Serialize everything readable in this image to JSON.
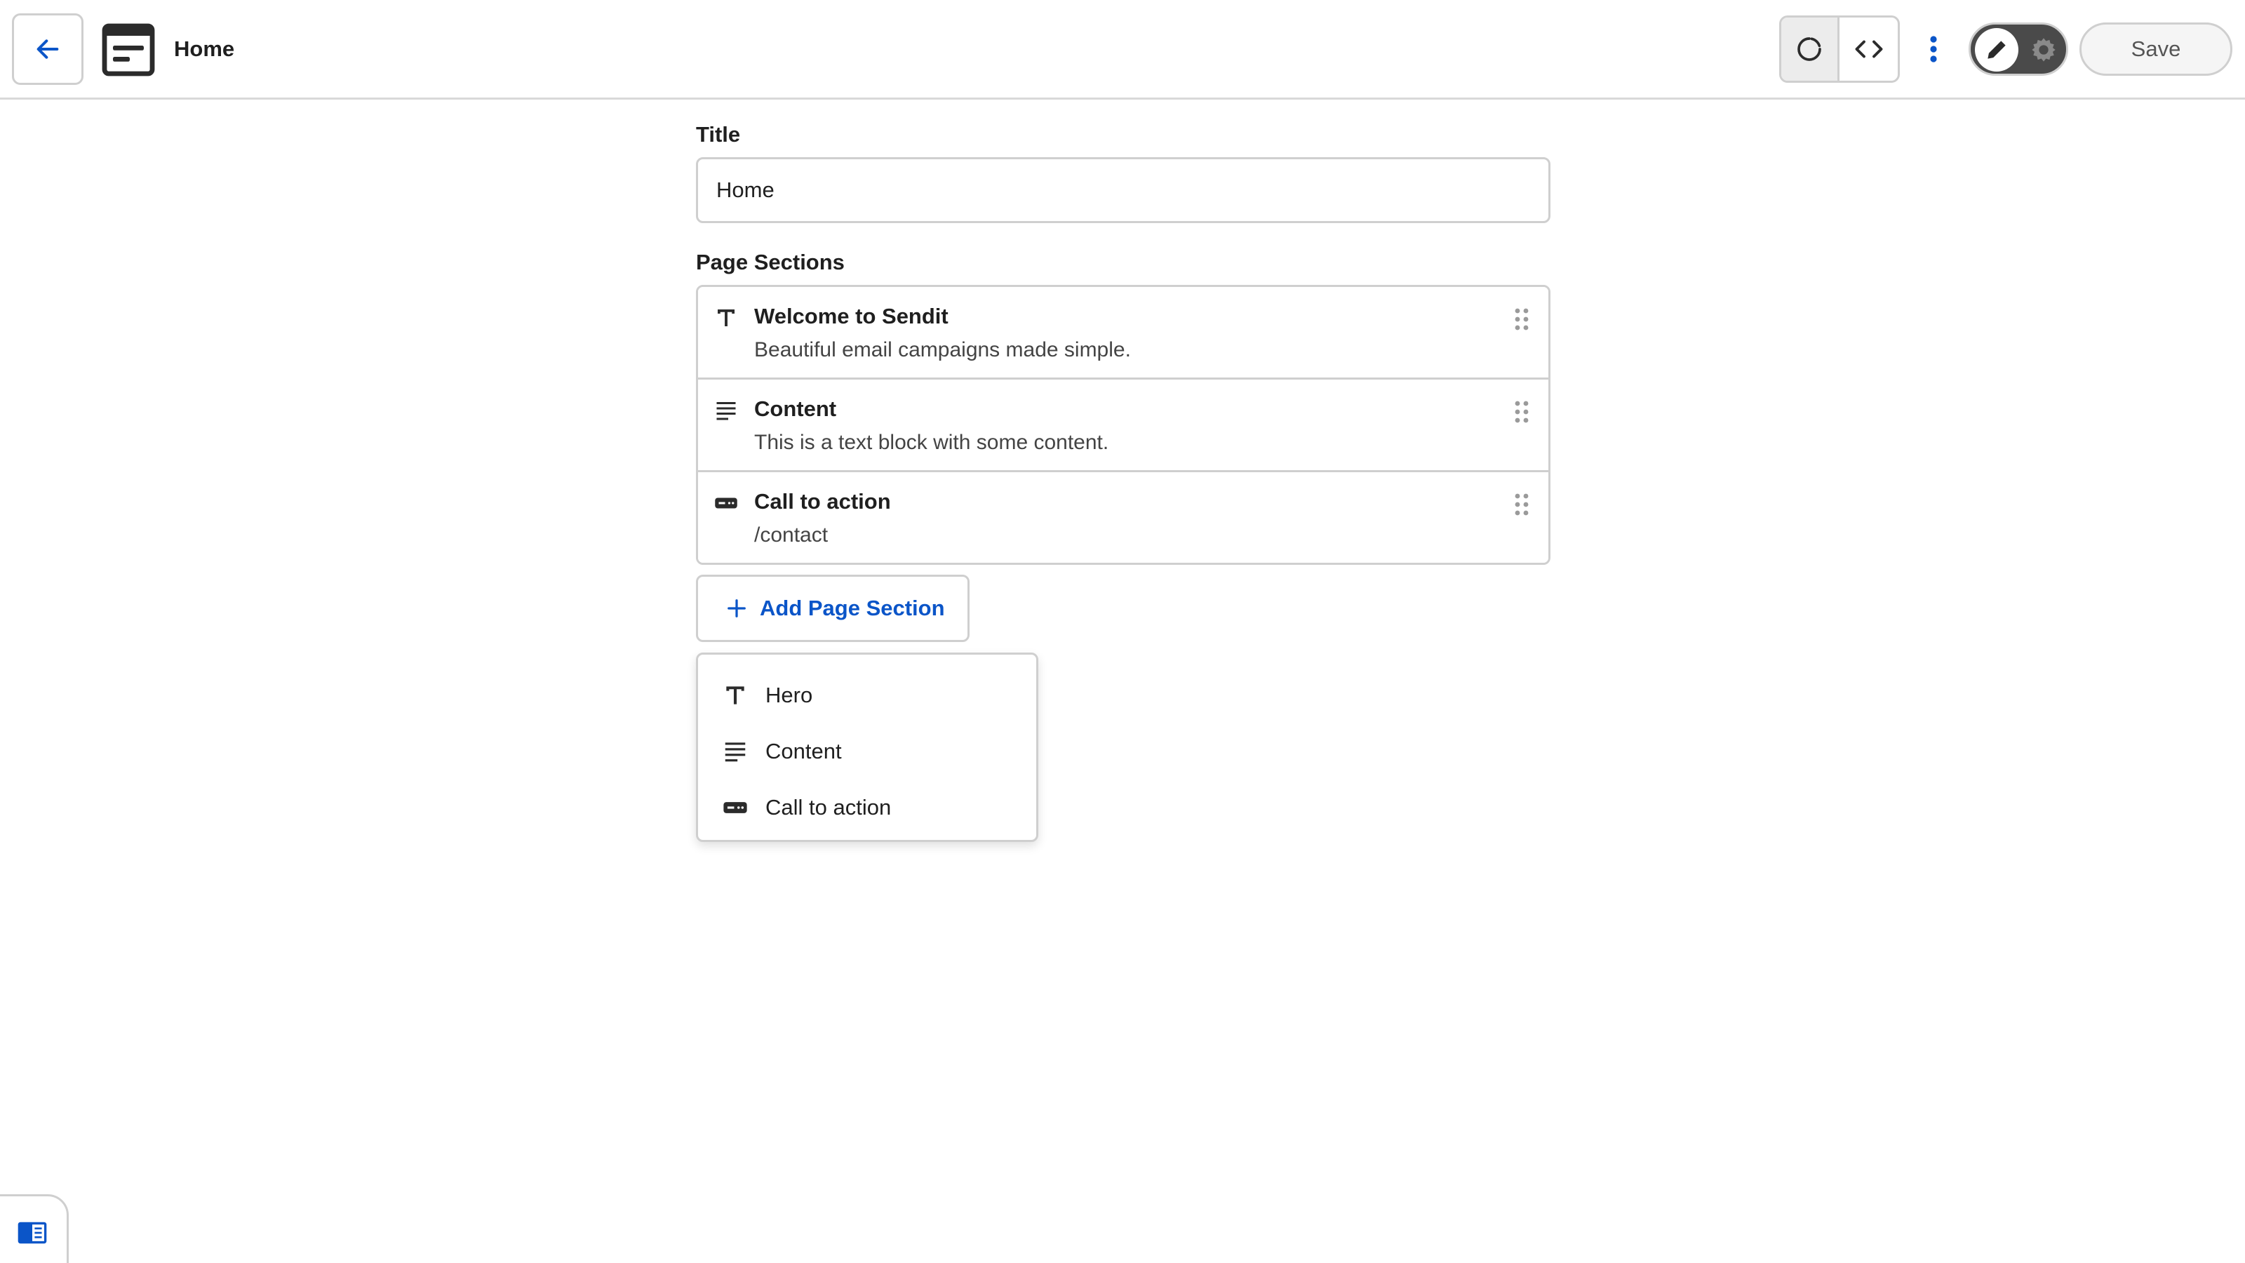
{
  "header": {
    "page_name": "Home",
    "save_label": "Save",
    "icons": {
      "back": "arrow-left-icon",
      "document": "document-icon",
      "reload": "reload-icon",
      "code": "code-icon",
      "more": "more-vertical-icon",
      "edit": "pencil-icon",
      "settings": "gear-icon"
    }
  },
  "form": {
    "title_label": "Title",
    "title_value": "Home",
    "sections_label": "Page Sections",
    "sections": [
      {
        "icon": "text-icon",
        "title": "Welcome to Sendit",
        "subtitle": "Beautiful email campaigns made simple."
      },
      {
        "icon": "paragraph-icon",
        "title": "Content",
        "subtitle": "This is a text block with some content."
      },
      {
        "icon": "button-icon",
        "title": "Call to action",
        "subtitle": "/contact"
      }
    ],
    "add_section_label": "Add Page Section"
  },
  "dropdown": {
    "items": [
      {
        "icon": "text-icon",
        "label": "Hero"
      },
      {
        "icon": "paragraph-icon",
        "label": "Content"
      },
      {
        "icon": "button-icon",
        "label": "Call to action"
      }
    ]
  },
  "colors": {
    "accent": "#0b55c8",
    "border": "#cfcfcf",
    "text": "#1f1f1f",
    "toggle_bg": "#4a4a4a"
  }
}
